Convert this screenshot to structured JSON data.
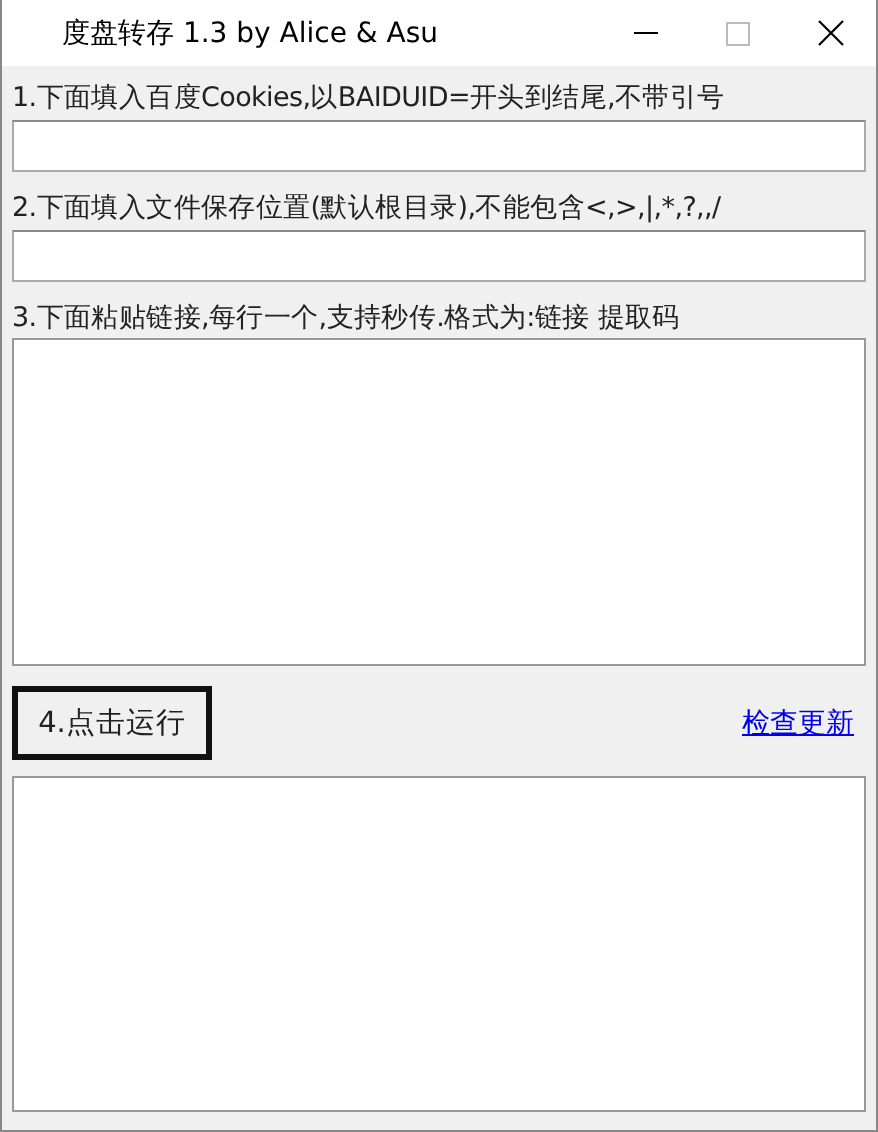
{
  "window": {
    "title": "度盘转存 1.3 by Alice & Asu"
  },
  "cookie_label": "1.下面填入百度Cookies,以BAIDUID=开头到结尾,不带引号",
  "folder_label": "2.下面填入文件保存位置(默认根目录),不能包含<,>,|,*,?,,/",
  "links_label": "3.下面粘贴链接,每行一个,支持秒传.格式为:链接 提取码",
  "run_button": "4.点击运行",
  "update_link": "检查更新"
}
